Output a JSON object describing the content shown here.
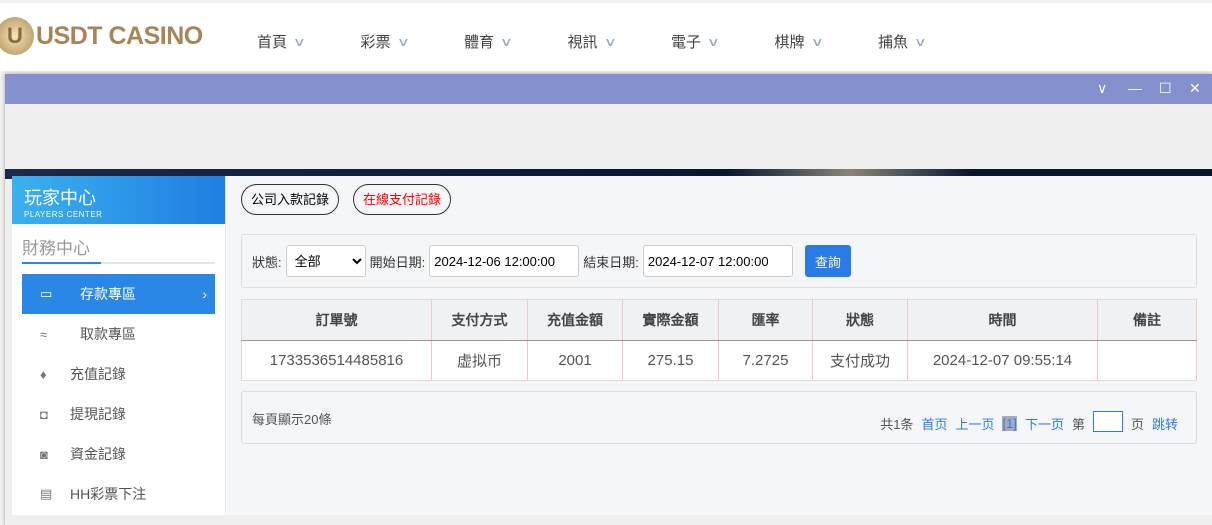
{
  "brand": {
    "name": "USDT CASINO",
    "logo_letter": "U"
  },
  "nav": [
    "首頁",
    "彩票",
    "體育",
    "視訊",
    "電子",
    "棋牌",
    "捕魚"
  ],
  "window_controls": [
    "chevron-down",
    "minimize",
    "maximize",
    "close"
  ],
  "sidebar": {
    "title": "玩家中心",
    "subtitle": "PLAYERS CENTER",
    "section": "財務中心",
    "items": [
      {
        "label": "存款專區",
        "icon": "card-icon",
        "active": true
      },
      {
        "label": "取款專區",
        "icon": "hand-money-icon"
      },
      {
        "label": "充值記錄",
        "icon": "money-bag-icon"
      },
      {
        "label": "提現記錄",
        "icon": "wallet-icon"
      },
      {
        "label": "資金記錄",
        "icon": "purse-icon"
      },
      {
        "label": "HH彩票下注",
        "icon": "list-icon"
      }
    ]
  },
  "tabs": [
    {
      "label": "公司入款記錄"
    },
    {
      "label": "在線支付記錄",
      "color": "#ff0000"
    }
  ],
  "filter": {
    "status_label": "狀態:",
    "status_value": "全部",
    "start_label": "開始日期:",
    "start_value": "2024-12-06 12:00:00",
    "end_label": "結束日期:",
    "end_value": "2024-12-07 12:00:00",
    "query": "查詢"
  },
  "table": {
    "headers": [
      "訂單號",
      "支付方式",
      "充值金額",
      "實際金額",
      "匯率",
      "狀態",
      "時間",
      "備註"
    ],
    "rows": [
      [
        "1733536514485816",
        "虚拟币",
        "2001",
        "275.15",
        "7.2725",
        "支付成功",
        "2024-12-07 09:55:14",
        ""
      ]
    ]
  },
  "pager": {
    "per_page": "每頁顯示20條",
    "total": "共1条",
    "first": "首页",
    "prev": "上一页",
    "current": "[1]",
    "next": "下一页",
    "page_pre": "第",
    "page_post": "页",
    "jump": "跳转"
  }
}
